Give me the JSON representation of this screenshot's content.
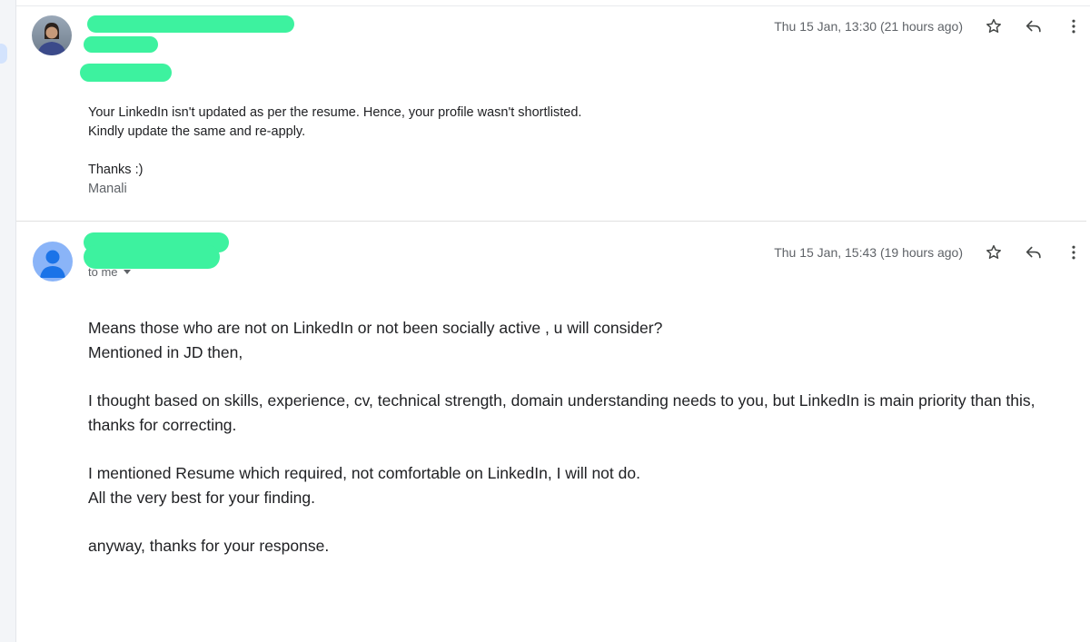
{
  "messages": [
    {
      "timestamp": "Thu 15 Jan, 13:30 (21 hours ago)",
      "icons": {
        "avatar": "sender-photo-avatar",
        "star": "star-icon",
        "reply": "reply-icon",
        "more": "more-vert-icon"
      },
      "body": [
        "Your LinkedIn isn't updated as per the resume. Hence, your profile wasn't shortlisted.",
        "Kindly update the same and re-apply.",
        "",
        "Thanks :)"
      ],
      "signature": "Manali"
    },
    {
      "timestamp": "Thu 15 Jan, 15:43 (19 hours ago)",
      "recipient": "to me",
      "icons": {
        "avatar": "default-person-avatar",
        "star": "star-icon",
        "reply": "reply-icon",
        "more": "more-vert-icon"
      },
      "body": [
        "Means those who are not on LinkedIn or not been socially active , u will consider?",
        "Mentioned in JD then,",
        "",
        "I thought based on skills, experience,  cv, technical strength, domain understanding needs to you, but LinkedIn is main priority than this, thanks for correcting.",
        "",
        "I mentioned Resume which required,  not comfortable on LinkedIn, I will not do.",
        "All the very best for your finding.",
        "",
        "anyway, thanks for your response."
      ]
    }
  ],
  "colors": {
    "redaction": "#3df29f",
    "meta_text": "#5f6368",
    "body_text": "#202124",
    "avatar_default_bg": "#8ab4f8",
    "avatar_default_fg": "#1a73e8"
  }
}
